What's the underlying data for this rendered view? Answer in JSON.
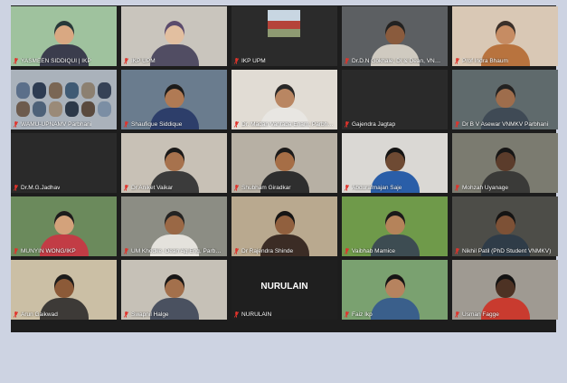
{
  "meeting": {
    "participants": [
      {
        "name": "YASMEEN SIDDIQUI | IKP",
        "scene": "#9fc29e",
        "skin": "#d9a882",
        "shirt": "#3b3d4d",
        "hair": "#27393a"
      },
      {
        "name": "IKP UPM",
        "scene": "#c9c5bd",
        "skin": "#e2bfa0",
        "shirt": "#514d63",
        "hair": "#5a4b6d"
      },
      {
        "name": "IKP UPM",
        "scene": "#2b2b2b",
        "photo": true
      },
      {
        "name": "Dr.D.N Gokhale, DI & Dean, VNMKV",
        "scene": "#5c5f62",
        "skin": "#8a5b3d",
        "shirt": "#cfcac0",
        "hair": "#222222"
      },
      {
        "name": "Prof Indra Bhaum",
        "scene": "#d9c8b5",
        "skin": "#c68c63",
        "shirt": "#b8733e",
        "hair": "#3a302a"
      },
      {
        "name": "WAMU-UPNAMV Parbhani",
        "scene": "#aab2bb",
        "crowd": true
      },
      {
        "name": "Shaufique Siddique",
        "scene": "#6a7c8e",
        "skin": "#b07a54",
        "shirt": "#2d3e6a",
        "hair": "#1b1b1b"
      },
      {
        "name": "Dr. Madan Vantaba Enam, Parbhani",
        "scene": "#e1dcd4",
        "skin": "#b98662",
        "shirt": "#e8e6e2",
        "hair": "#282828"
      },
      {
        "name": "Gajendra Jagtap",
        "scene": "#2a2a2a",
        "blank": true
      },
      {
        "name": "Dr B V Asewar VNMKV Parbhani",
        "scene": "#5f6a6c",
        "skin": "#9e6d4c",
        "shirt": "#3f4a55",
        "hair": "#222222"
      },
      {
        "name": "Dr.M.G.Jadhav",
        "scene": "#2a2a2a",
        "blank": true
      },
      {
        "name": "Dr Aniket Vaikar",
        "scene": "#c8c1b6",
        "skin": "#a7724d",
        "shirt": "#3b3b3b",
        "hair": "#1a1a1a"
      },
      {
        "name": "Shubham Giradkar",
        "scene": "#b7b0a4",
        "skin": "#a66e46",
        "shirt": "#2e2e2e",
        "hair": "#1b1b1b"
      },
      {
        "name": "Abdurafmajan Saje",
        "scene": "#dad8d4",
        "skin": "#6e4a33",
        "shirt": "#2a5ea8",
        "hair": "#151515"
      },
      {
        "name": "Mohzah Uyanage",
        "scene": "#7b7b70",
        "skin": "#5b3c2b",
        "shirt": "#3a3a38",
        "hair": "#161616"
      },
      {
        "name": "MUNYIN WONG/IKP",
        "scene": "#6b8a5c",
        "skin": "#d3a27b",
        "shirt": "#c23c45",
        "hair": "#1c1c1c"
      },
      {
        "name": "UM Khodke, Dean Ag Eng, Parbhani",
        "scene": "#8c8d84",
        "skin": "#9a6845",
        "shirt": "#e4e2dc",
        "hair": "#232323"
      },
      {
        "name": "Dr Rajendra Shinde",
        "scene": "#b9a98f",
        "skin": "#91603e",
        "shirt": "#3b2c25",
        "hair": "#151515"
      },
      {
        "name": "Vaibhab Mamice",
        "scene": "#6f9a4a",
        "skin": "#b5835a",
        "shirt": "#3d4c52",
        "hair": "#1a1a1a"
      },
      {
        "name": "Nikhil Patil (PhD Student VNMKV)",
        "scene": "#4d4d48",
        "skin": "#7d5136",
        "shirt": "#2f3c48",
        "hair": "#141414"
      },
      {
        "name": "Arun Gaikwad",
        "scene": "#cbbfa5",
        "skin": "#8c5a38",
        "shirt": "#3d3a37",
        "hair": "#1c1c1c"
      },
      {
        "name": "Swapnil Halge",
        "scene": "#c6c1b7",
        "skin": "#a3704c",
        "shirt": "#4a5160",
        "hair": "#171717"
      },
      {
        "name": "NURULAIN",
        "scene": "#1f1f1f",
        "blank": true,
        "label": "NURULAIN",
        "active": true
      },
      {
        "name": "Faiz Ikp",
        "scene": "#7aa170",
        "skin": "#b6835f",
        "shirt": "#3a5f8b",
        "hair": "#151515"
      },
      {
        "name": "Usman Fagge",
        "scene": "#9f9a92",
        "skin": "#4d3224",
        "shirt": "#c93b2f",
        "hair": "#121212"
      }
    ],
    "empty_row_tiles": 5
  },
  "colors": {
    "background": "#cdd3e2",
    "frame": "#1d1d1d",
    "muted_mic": "#e0332b",
    "active_speaker": "#d8d000"
  }
}
